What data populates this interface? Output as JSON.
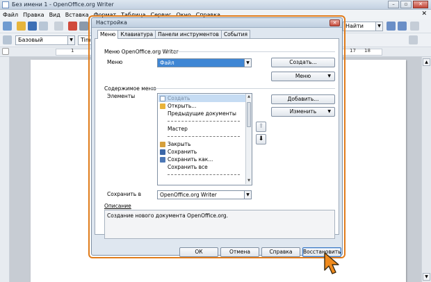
{
  "app": {
    "title": "Без имени 1 - OpenOffice.org Writer",
    "menus": [
      "Файл",
      "Правка",
      "Вид",
      "Вставка",
      "Формат",
      "Таблица",
      "Сервис",
      "Окно",
      "Справка"
    ],
    "toolbar": {
      "style_value": "Базовый",
      "font_value": "Times",
      "search_value": "Найти"
    },
    "ruler": {
      "left_mark": "1",
      "right_marks": [
        "17",
        "18"
      ]
    }
  },
  "dialog": {
    "title": "Настройка",
    "tabs": [
      "Меню",
      "Клавиатура",
      "Панели инструментов",
      "События"
    ],
    "menu_group": {
      "title": "Меню OpenOffice.org Writer",
      "menu_label": "Меню",
      "menu_value": "Файл",
      "create_button": "Создать...",
      "menu_button": "Меню"
    },
    "content_group": {
      "title": "Содержимое меню",
      "elements_label": "Элементы",
      "items": [
        {
          "label": "Создать",
          "icon": "new-document-icon",
          "selected": true
        },
        {
          "label": "Открыть...",
          "icon": "open-folder-icon"
        },
        {
          "label": "Предыдущие документы",
          "icon": ""
        },
        {
          "label": "",
          "separator": true
        },
        {
          "label": "Мастер",
          "icon": ""
        },
        {
          "label": "",
          "separator": true
        },
        {
          "label": "Закрыть",
          "icon": "close-document-icon"
        },
        {
          "label": "Сохранить",
          "icon": "save-icon"
        },
        {
          "label": "Сохранить как...",
          "icon": "save-as-icon"
        },
        {
          "label": "Сохранить все",
          "icon": ""
        },
        {
          "label": "",
          "separator": true
        }
      ],
      "add_button": "Добавить...",
      "modify_button": "Изменить",
      "save_in_label": "Сохранить в",
      "save_in_value": "OpenOffice.org Writer"
    },
    "description": {
      "label": "Описание",
      "text": "Создание нового документа OpenOffice.org."
    },
    "buttons": {
      "ok": "ОК",
      "cancel": "Отмена",
      "help": "Справка",
      "restore": "Восстановить"
    }
  },
  "colors": {
    "highlight_outline": "#e07b1a",
    "selection": "#3f86d4",
    "dialog_bg": "#dfe7f0"
  }
}
